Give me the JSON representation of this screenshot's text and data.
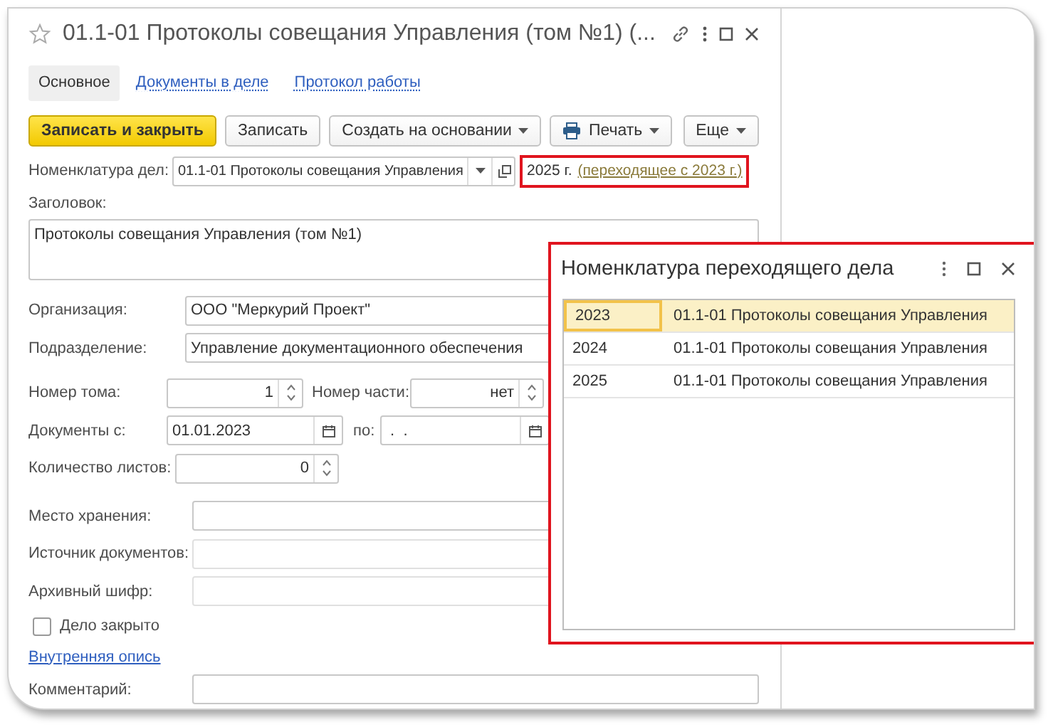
{
  "window": {
    "title": "01.1-01 Протоколы совещания Управления (том №1) (..."
  },
  "tabs": [
    {
      "label": "Основное",
      "selected": true
    },
    {
      "label": "Документы в деле",
      "selected": false
    },
    {
      "label": "Протокол работы",
      "selected": false
    }
  ],
  "toolbar": [
    {
      "label": "Записать и закрыть",
      "kind": "primary"
    },
    {
      "label": "Записать",
      "kind": "plain"
    },
    {
      "label": "Создать на основании",
      "kind": "menu"
    },
    {
      "label": "Печать",
      "kind": "print_menu"
    },
    {
      "label": "Еще",
      "kind": "menu"
    }
  ],
  "nomenclature": {
    "label": "Номенклатура дел:",
    "value": "01.1-01 Протоколы совещания Управления",
    "year": "2025 г.",
    "transition_link": "(переходящее с 2023 г.)"
  },
  "heading": {
    "label": "Заголовок:",
    "value": "Протоколы совещания Управления (том №1)"
  },
  "organization": {
    "label": "Организация:",
    "value": "ООО \"Меркурий Проект\""
  },
  "department": {
    "label": "Подразделение:",
    "value": "Управление документационного обеспечения"
  },
  "volume": {
    "label": "Номер тома:",
    "value": "1"
  },
  "part": {
    "label": "Номер части:",
    "value": "нет"
  },
  "docs_from": {
    "label": "Документы с:",
    "value": "01.01.2023"
  },
  "docs_to": {
    "label": "по:",
    "value": " .  . "
  },
  "sheet_count": {
    "label": "Количество листов:",
    "value": "0"
  },
  "storage": {
    "label": "Место хранения:"
  },
  "source": {
    "label": "Источник документов:"
  },
  "archive_code": {
    "label": "Архивный шифр:"
  },
  "closed": {
    "label": "Дело закрыто",
    "checked": false
  },
  "inventory_link": {
    "label": "Внутренняя опись"
  },
  "comment": {
    "label": "Комментарий:"
  },
  "popup": {
    "title": "Номенклатура переходящего дела",
    "rows": [
      {
        "year": "2023",
        "name": "01.1-01 Протоколы совещания Управления",
        "selected": true
      },
      {
        "year": "2024",
        "name": "01.1-01 Протоколы совещания Управления",
        "selected": false
      },
      {
        "year": "2025",
        "name": "01.1-01 Протоколы совещания Управления",
        "selected": false
      }
    ]
  }
}
